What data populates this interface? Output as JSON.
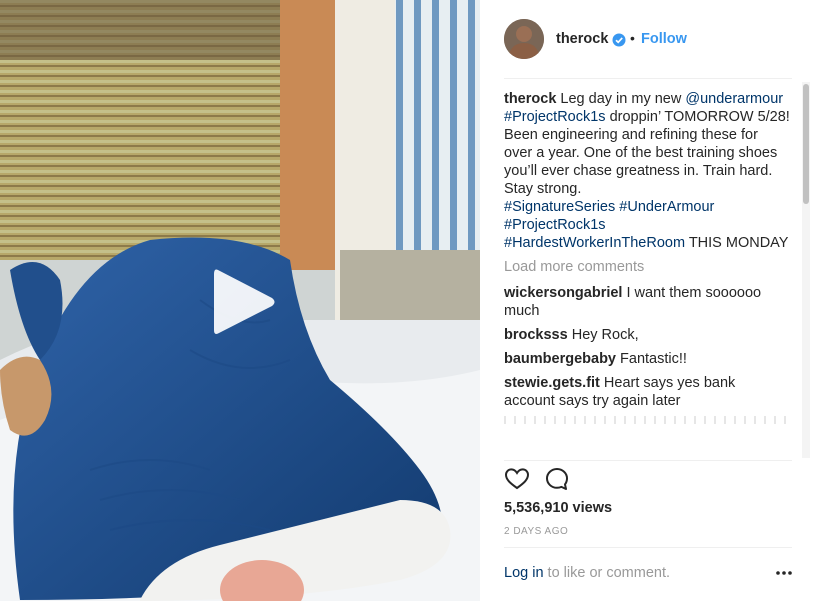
{
  "post": {
    "username": "therock",
    "follow_label": "Follow",
    "dot": "•",
    "caption": {
      "username": "therock",
      "text_1": " Leg day in my new ",
      "mention": "@underarmour",
      "text_space": " ",
      "tag_1": "#ProjectRock1s",
      "text_2": " droppin’ TOMORROW 5/28!",
      "text_3": "Been engineering and refining these for over a year. One of the best training shoes you’ll ever chase greatness in. Train hard. Stay strong.",
      "tag_2": "#SignatureSeries",
      "tag_3": "#UnderArmour",
      "tag_4": "#ProjectRock1s",
      "tag_5": "#HardestWorkerInTheRoom",
      "text_4": " THIS MONDAY"
    },
    "load_more": "Load more comments",
    "comments": [
      {
        "username": "wickersongabriel",
        "text": " I want them soooooo much"
      },
      {
        "username": "brocksss",
        "text": " Hey Rock,"
      },
      {
        "username": "baumbergebaby",
        "text": " Fantastic!!"
      },
      {
        "username": "stewie.gets.fit",
        "text": " Heart says yes bank account says try again later"
      }
    ],
    "views": "5,536,910 views",
    "time": "2 DAYS AGO",
    "login_link": "Log in",
    "login_text": " to like or comment."
  },
  "colors": {
    "follow": "#3897f0",
    "link": "#003569",
    "muted": "#999999",
    "verified": "#3897f0"
  },
  "icons": [
    "play-icon",
    "verified-icon",
    "heart-icon",
    "comment-icon",
    "more-options-icon"
  ]
}
